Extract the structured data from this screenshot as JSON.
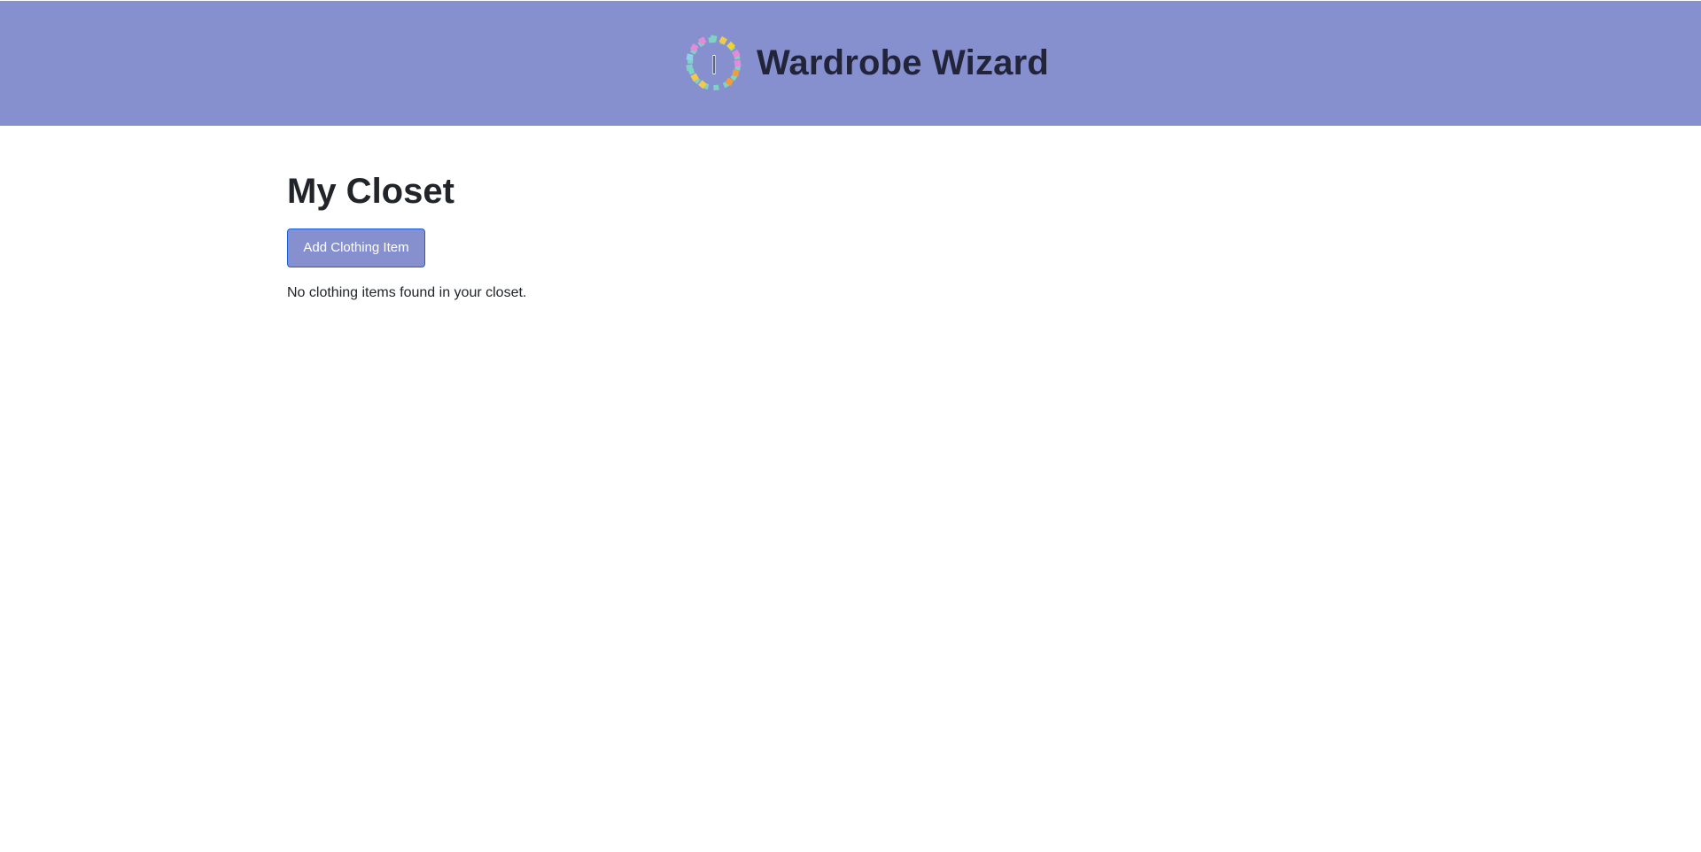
{
  "header": {
    "app_title": "Wardrobe Wizard",
    "logo_icon": "dashed-rainbow-circle-icon",
    "background_color": "#8790cf"
  },
  "main": {
    "page_title": "My Closet",
    "add_button_label": "Add Clothing Item",
    "empty_message": "No clothing items found in your closet."
  },
  "colors": {
    "accent": "#8790cf",
    "button_border": "#1a5fd6",
    "text": "#212529"
  }
}
